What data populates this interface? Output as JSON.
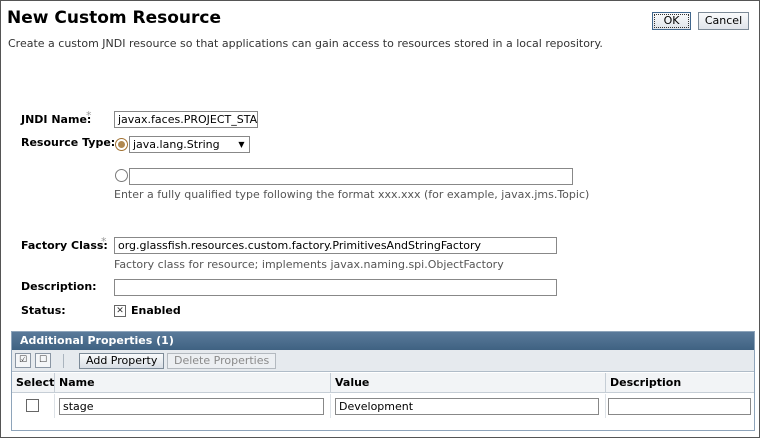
{
  "header": {
    "title": "New Custom Resource",
    "description": "Create a custom JNDI resource so that applications can gain access to resources stored in a local repository.",
    "ok_label": "OK",
    "cancel_label": "Cancel"
  },
  "form": {
    "jndi_name": {
      "label": "JNDI Name:",
      "required_mark": "*",
      "value": "javax.faces.PROJECT_STA"
    },
    "resource_type": {
      "label": "Resource Type:",
      "selected_option": "java.lang.String",
      "custom_value": "",
      "help": "Enter a fully qualified type following the format xxx.xxx (for example, javax.jms.Topic)"
    },
    "factory_class": {
      "label": "Factory Class:",
      "required_mark": "*",
      "value": "org.glassfish.resources.custom.factory.PrimitivesAndStringFactory",
      "help": "Factory class for resource; implements javax.naming.spi.ObjectFactory"
    },
    "description": {
      "label": "Description:",
      "value": ""
    },
    "status": {
      "label": "Status:",
      "checkbox_label": "Enabled",
      "checked": true
    }
  },
  "properties": {
    "title": "Additional Properties (1)",
    "add_label": "Add Property",
    "delete_label": "Delete Properties",
    "columns": [
      "Select",
      "Name",
      "Value",
      "Description"
    ],
    "rows": [
      {
        "selected": false,
        "name": "stage",
        "value": "Development",
        "description": ""
      }
    ]
  }
}
